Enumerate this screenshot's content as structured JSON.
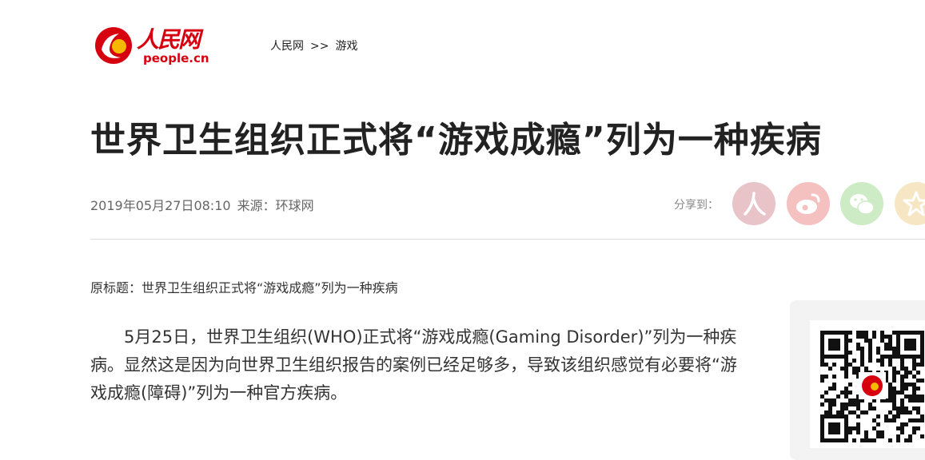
{
  "header": {
    "logo_cn": "人民网",
    "logo_en": "people.cn",
    "breadcrumb": {
      "home": "人民网",
      "separator": ">>",
      "section": "游戏"
    }
  },
  "article": {
    "title": "世界卫生组织正式将“游戏成瘾”列为一种疾病",
    "date": "2019年05月27日08:10",
    "source": "来源：环球网",
    "original_title": "原标题：世界卫生组织正式将“游戏成瘾”列为一种疾病",
    "paragraph": "5月25日，世界卫生组织(WHO)正式将“游戏成瘾(Gaming Disorder)”列为一种疾病。显然这是因为向世界卫生组织报告的案例已经足够多，导致该组织感觉有必要将“游戏成瘾(障碍)”列为一种官方疾病。"
  },
  "share": {
    "label": "分享到：",
    "buttons": [
      {
        "name": "people-share-button",
        "icon": "people-icon",
        "color": "#e8c4c8"
      },
      {
        "name": "weibo-share-button",
        "icon": "weibo-icon",
        "color": "#f5c0c0"
      },
      {
        "name": "wechat-share-button",
        "icon": "wechat-icon",
        "color": "#cdebc4"
      },
      {
        "name": "favorite-share-button",
        "icon": "star-icon",
        "color": "#f7e6c4"
      }
    ]
  },
  "colors": {
    "brand_red": "#d7000f",
    "title_text": "#222222",
    "meta_text": "#666666"
  }
}
